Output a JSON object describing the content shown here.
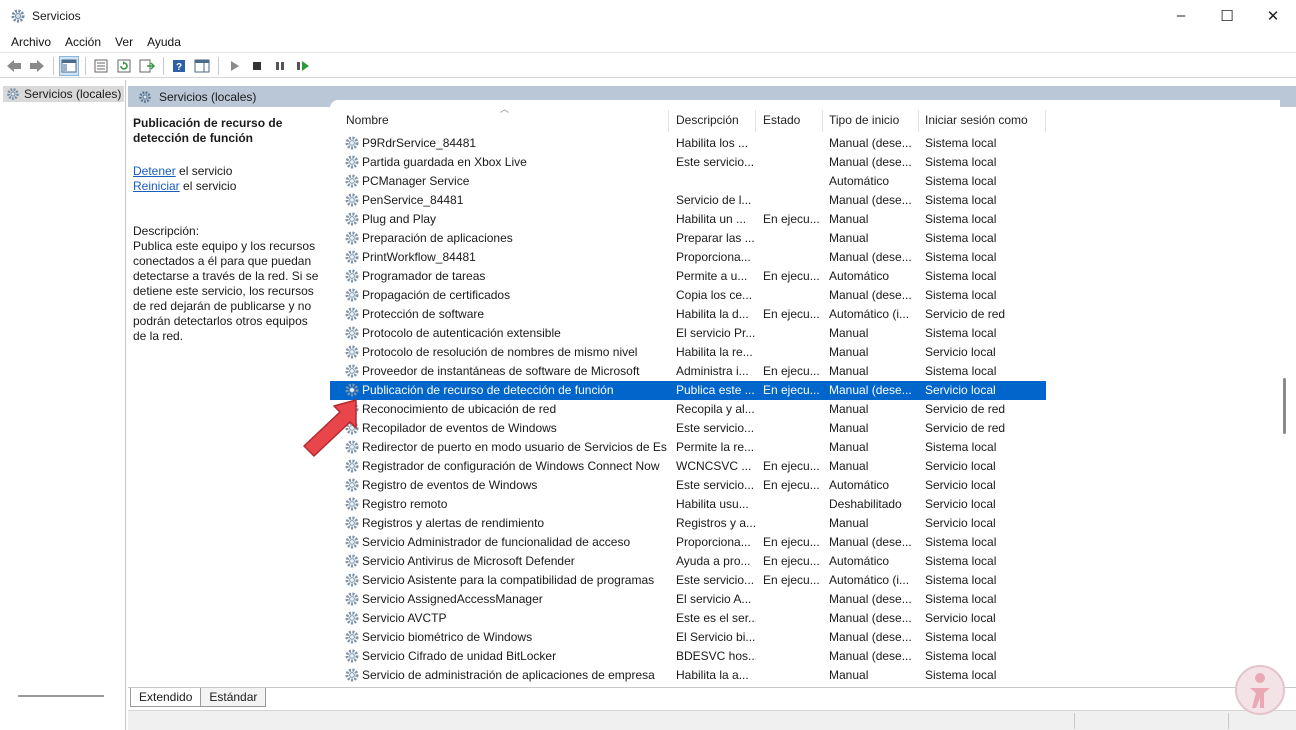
{
  "window": {
    "title": "Servicios",
    "controls": [
      "–",
      "☐",
      "✕"
    ]
  },
  "menu": [
    "Archivo",
    "Acción",
    "Ver",
    "Ayuda"
  ],
  "tree": {
    "root_label": "Servicios (locales)"
  },
  "pane_header": "Servicios (locales)",
  "details": {
    "service_title": "Publicación de recurso de detección de función",
    "stop_link": "Detener",
    "stop_suffix": " el servicio",
    "restart_link": "Reiniciar",
    "restart_suffix": " el servicio",
    "description_label": "Descripción:",
    "description_text": "Publica este equipo y los recursos conectados a él para que puedan detectarse a través de la red. Si se detiene este servicio, los recursos de red dejarán de publicarse y no podrán detectarlos otros equipos de la red."
  },
  "columns": [
    "Nombre",
    "Descripción",
    "Estado",
    "Tipo de inicio",
    "Iniciar sesión como"
  ],
  "rows": [
    [
      "P9RdrService_84481",
      "Habilita los ...",
      "",
      "Manual (dese...",
      "Sistema local"
    ],
    [
      "Partida guardada en Xbox Live",
      "Este servicio...",
      "",
      "Manual (dese...",
      "Sistema local"
    ],
    [
      "PCManager Service",
      "",
      "",
      "Automático",
      "Sistema local"
    ],
    [
      "PenService_84481",
      "Servicio de l...",
      "",
      "Manual (dese...",
      "Sistema local"
    ],
    [
      "Plug and Play",
      "Habilita un ...",
      "En ejecu...",
      "Manual",
      "Sistema local"
    ],
    [
      "Preparación de aplicaciones",
      "Preparar las ...",
      "",
      "Manual",
      "Sistema local"
    ],
    [
      "PrintWorkflow_84481",
      "Proporciona...",
      "",
      "Manual (dese...",
      "Sistema local"
    ],
    [
      "Programador de tareas",
      "Permite a u...",
      "En ejecu...",
      "Automático",
      "Sistema local"
    ],
    [
      "Propagación de certificados",
      "Copia los ce...",
      "",
      "Manual (dese...",
      "Sistema local"
    ],
    [
      "Protección de software",
      "Habilita la d...",
      "En ejecu...",
      "Automático (i...",
      "Servicio de red"
    ],
    [
      "Protocolo de autenticación extensible",
      "El servicio Pr...",
      "",
      "Manual",
      "Sistema local"
    ],
    [
      "Protocolo de resolución de nombres de mismo nivel",
      "Habilita la re...",
      "",
      "Manual",
      "Servicio local"
    ],
    [
      "Proveedor de instantáneas de software de Microsoft",
      "Administra i...",
      "En ejecu...",
      "Manual",
      "Sistema local"
    ],
    [
      "Publicación de recurso de detección de función",
      "Publica este ...",
      "En ejecu...",
      "Manual (dese...",
      "Servicio local"
    ],
    [
      "Reconocimiento de ubicación de red",
      "Recopila y al...",
      "",
      "Manual",
      "Servicio de red"
    ],
    [
      "Recopilador de eventos de Windows",
      "Este servicio...",
      "",
      "Manual",
      "Servicio de red"
    ],
    [
      "Redirector de puerto en modo usuario de Servicios de Es...",
      "Permite la re...",
      "",
      "Manual",
      "Sistema local"
    ],
    [
      "Registrador de configuración de Windows Connect Now",
      "WCNCSVC ...",
      "En ejecu...",
      "Manual",
      "Servicio local"
    ],
    [
      "Registro de eventos de Windows",
      "Este servicio...",
      "En ejecu...",
      "Automático",
      "Servicio local"
    ],
    [
      "Registro remoto",
      "Habilita usu...",
      "",
      "Deshabilitado",
      "Servicio local"
    ],
    [
      "Registros y alertas de rendimiento",
      "Registros y a...",
      "",
      "Manual",
      "Servicio local"
    ],
    [
      "Servicio Administrador de funcionalidad de acceso",
      "Proporciona...",
      "En ejecu...",
      "Manual (dese...",
      "Sistema local"
    ],
    [
      "Servicio Antivirus de Microsoft Defender",
      "Ayuda a pro...",
      "En ejecu...",
      "Automático",
      "Sistema local"
    ],
    [
      "Servicio Asistente para la compatibilidad de programas",
      "Este servicio...",
      "En ejecu...",
      "Automático (i...",
      "Sistema local"
    ],
    [
      "Servicio AssignedAccessManager",
      "El servicio A...",
      "",
      "Manual (dese...",
      "Sistema local"
    ],
    [
      "Servicio AVCTP",
      "Este es el ser...",
      "",
      "Manual (dese...",
      "Servicio local"
    ],
    [
      "Servicio biométrico de Windows",
      "El Servicio bi...",
      "",
      "Manual (dese...",
      "Sistema local"
    ],
    [
      "Servicio Cifrado de unidad BitLocker",
      "BDESVC hos...",
      "",
      "Manual (dese...",
      "Sistema local"
    ],
    [
      "Servicio de administración de aplicaciones de empresa",
      "Habilita la a...",
      "",
      "Manual",
      "Sistema local"
    ]
  ],
  "selected_row_index": 13,
  "tabs": [
    "Extendido",
    "Estándar"
  ],
  "active_tab": "Extendido",
  "colors": {
    "selection": "#0066cc",
    "header_band": "#b9c7d6",
    "link": "#1a5ebf",
    "annotation_arrow": "#e8464a"
  }
}
